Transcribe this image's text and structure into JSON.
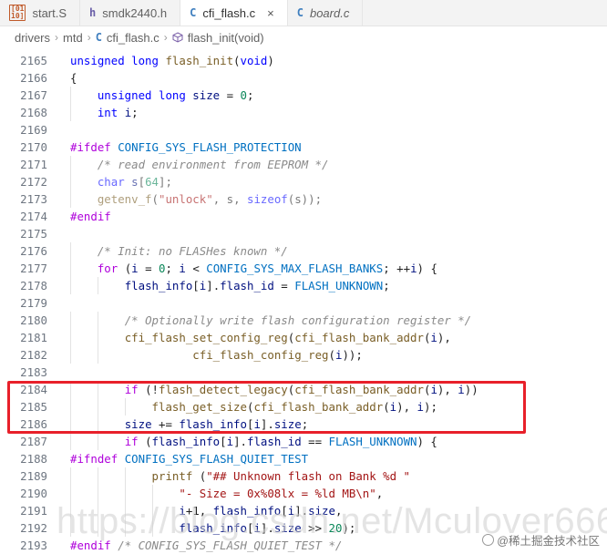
{
  "tabs": [
    {
      "label": "start.S",
      "icon": "asm-file-icon",
      "glyph": "[01\n10]",
      "active": false,
      "italic": false
    },
    {
      "label": "smdk2440.h",
      "icon": "h-file-icon",
      "glyph": "h",
      "active": false,
      "italic": false
    },
    {
      "label": "cfi_flash.c",
      "icon": "c-file-icon",
      "glyph": "C",
      "active": true,
      "italic": false
    },
    {
      "label": "board.c",
      "icon": "c-file-icon",
      "glyph": "C",
      "active": false,
      "italic": true
    }
  ],
  "active_tab_close": "×",
  "breadcrumb": {
    "items": [
      "drivers",
      "mtd",
      "cfi_flash.c",
      "flash_init(void)"
    ],
    "separator": "›",
    "file_glyph": "C"
  },
  "code": {
    "lines": [
      {
        "n": "2165",
        "t": [
          [
            "kw",
            "unsigned long "
          ],
          [
            "fn",
            "flash_init"
          ],
          [
            "",
            "("
          ],
          [
            "kw",
            "void"
          ],
          [
            "",
            ")"
          ]
        ]
      },
      {
        "n": "2166",
        "t": [
          [
            "",
            "{"
          ]
        ]
      },
      {
        "n": "2167",
        "i": 1,
        "t": [
          [
            "kw",
            "unsigned long "
          ],
          [
            "va",
            "size"
          ],
          [
            "",
            " = "
          ],
          [
            "nm",
            "0"
          ],
          [
            "",
            ";"
          ]
        ]
      },
      {
        "n": "2168",
        "i": 1,
        "t": [
          [
            "kw",
            "int "
          ],
          [
            "va",
            "i"
          ],
          [
            "",
            ";"
          ]
        ]
      },
      {
        "n": "2169",
        "t": []
      },
      {
        "n": "2170",
        "t": [
          [
            "pp",
            "#ifdef "
          ],
          [
            "mc",
            "CONFIG_SYS_FLASH_PROTECTION"
          ]
        ]
      },
      {
        "n": "2171",
        "i": 1,
        "t": [
          [
            "cm",
            "/* read environment from EEPROM */"
          ]
        ]
      },
      {
        "n": "2172",
        "i": 1,
        "dim": true,
        "t": [
          [
            "kw",
            "char "
          ],
          [
            "va",
            "s"
          ],
          [
            "",
            "["
          ],
          [
            "nm",
            "64"
          ],
          [
            "",
            "];"
          ]
        ]
      },
      {
        "n": "2173",
        "i": 1,
        "dim": true,
        "t": [
          [
            "fn",
            "getenv_f"
          ],
          [
            "",
            "("
          ],
          [
            "st",
            "\"unlock\""
          ],
          [
            "",
            ", s, "
          ],
          [
            "kw",
            "sizeof"
          ],
          [
            "",
            "(s));"
          ]
        ]
      },
      {
        "n": "2174",
        "t": [
          [
            "pp",
            "#endif"
          ]
        ]
      },
      {
        "n": "2175",
        "t": []
      },
      {
        "n": "2176",
        "i": 1,
        "t": [
          [
            "cm",
            "/* Init: no FLASHes known */"
          ]
        ]
      },
      {
        "n": "2177",
        "i": 1,
        "t": [
          [
            "pp",
            "for"
          ],
          [
            "",
            " ("
          ],
          [
            "va",
            "i"
          ],
          [
            "",
            " = "
          ],
          [
            "nm",
            "0"
          ],
          [
            "",
            "; "
          ],
          [
            "va",
            "i"
          ],
          [
            "",
            " < "
          ],
          [
            "mc",
            "CONFIG_SYS_MAX_FLASH_BANKS"
          ],
          [
            "",
            "; ++"
          ],
          [
            "va",
            "i"
          ],
          [
            "",
            ") {"
          ]
        ]
      },
      {
        "n": "2178",
        "i": 2,
        "t": [
          [
            "va",
            "flash_info"
          ],
          [
            "",
            "["
          ],
          [
            "va",
            "i"
          ],
          [
            "",
            "]."
          ],
          [
            "va",
            "flash_id"
          ],
          [
            "",
            " = "
          ],
          [
            "mc",
            "FLASH_UNKNOWN"
          ],
          [
            "",
            ";"
          ]
        ]
      },
      {
        "n": "2179",
        "t": []
      },
      {
        "n": "2180",
        "i": 2,
        "t": [
          [
            "cm",
            "/* Optionally write flash configuration register */"
          ]
        ]
      },
      {
        "n": "2181",
        "i": 2,
        "t": [
          [
            "fn",
            "cfi_flash_set_config_reg"
          ],
          [
            "",
            "("
          ],
          [
            "fn",
            "cfi_flash_bank_addr"
          ],
          [
            "",
            "("
          ],
          [
            "va",
            "i"
          ],
          [
            "",
            "),"
          ]
        ]
      },
      {
        "n": "2182",
        "i": 2,
        "t": [
          [
            "",
            "          "
          ],
          [
            "fn",
            "cfi_flash_config_reg"
          ],
          [
            "",
            "("
          ],
          [
            "va",
            "i"
          ],
          [
            "",
            "));"
          ]
        ]
      },
      {
        "n": "2183",
        "t": []
      },
      {
        "n": "2184",
        "i": 2,
        "t": [
          [
            "pp",
            "if"
          ],
          [
            "",
            " (!"
          ],
          [
            "fn",
            "flash_detect_legacy"
          ],
          [
            "",
            "("
          ],
          [
            "fn",
            "cfi_flash_bank_addr"
          ],
          [
            "",
            "("
          ],
          [
            "va",
            "i"
          ],
          [
            "",
            "), "
          ],
          [
            "va",
            "i"
          ],
          [
            "",
            "))"
          ]
        ]
      },
      {
        "n": "2185",
        "i": 3,
        "t": [
          [
            "fn",
            "flash_get_size"
          ],
          [
            "",
            "("
          ],
          [
            "fn",
            "cfi_flash_bank_addr"
          ],
          [
            "",
            "("
          ],
          [
            "va",
            "i"
          ],
          [
            "",
            "), "
          ],
          [
            "va",
            "i"
          ],
          [
            "",
            ");"
          ]
        ]
      },
      {
        "n": "2186",
        "i": 2,
        "t": [
          [
            "va",
            "size"
          ],
          [
            "",
            " += "
          ],
          [
            "va",
            "flash_info"
          ],
          [
            "",
            "["
          ],
          [
            "va",
            "i"
          ],
          [
            "",
            "]."
          ],
          [
            "va",
            "size"
          ],
          [
            "",
            ";"
          ]
        ]
      },
      {
        "n": "2187",
        "i": 2,
        "t": [
          [
            "pp",
            "if"
          ],
          [
            "",
            " ("
          ],
          [
            "va",
            "flash_info"
          ],
          [
            "",
            "["
          ],
          [
            "va",
            "i"
          ],
          [
            "",
            "]."
          ],
          [
            "va",
            "flash_id"
          ],
          [
            "",
            " == "
          ],
          [
            "mc",
            "FLASH_UNKNOWN"
          ],
          [
            "",
            ") {"
          ]
        ]
      },
      {
        "n": "2188",
        "t": [
          [
            "pp",
            "#ifndef "
          ],
          [
            "mc",
            "CONFIG_SYS_FLASH_QUIET_TEST"
          ]
        ]
      },
      {
        "n": "2189",
        "i": 3,
        "t": [
          [
            "fn",
            "printf"
          ],
          [
            "",
            " ("
          ],
          [
            "st",
            "\"## Unknown flash on Bank %d \""
          ]
        ]
      },
      {
        "n": "2190",
        "i": 4,
        "t": [
          [
            "st",
            "\"- Size = 0x%08lx = %ld MB\\n\""
          ],
          [
            "",
            ","
          ]
        ]
      },
      {
        "n": "2191",
        "i": 4,
        "t": [
          [
            "va",
            "i"
          ],
          [
            "",
            "+1, "
          ],
          [
            "va",
            "flash_info"
          ],
          [
            "",
            "["
          ],
          [
            "va",
            "i"
          ],
          [
            "",
            "]."
          ],
          [
            "va",
            "size"
          ],
          [
            "",
            ","
          ]
        ]
      },
      {
        "n": "2192",
        "i": 4,
        "t": [
          [
            "va",
            "flash_info"
          ],
          [
            "",
            "["
          ],
          [
            "va",
            "i"
          ],
          [
            "",
            "]."
          ],
          [
            "va",
            "size"
          ],
          [
            "",
            " >> "
          ],
          [
            "nm",
            "20"
          ],
          [
            "",
            ");"
          ]
        ]
      },
      {
        "n": "2193",
        "t": [
          [
            "pp",
            "#endif "
          ],
          [
            "cm",
            "/* CONFIG_SYS_FLASH_QUIET_TEST */"
          ]
        ]
      }
    ]
  },
  "watermark": "https://blog.csdn.net/Mculover666",
  "site_badge": "@稀土掘金技术社区"
}
